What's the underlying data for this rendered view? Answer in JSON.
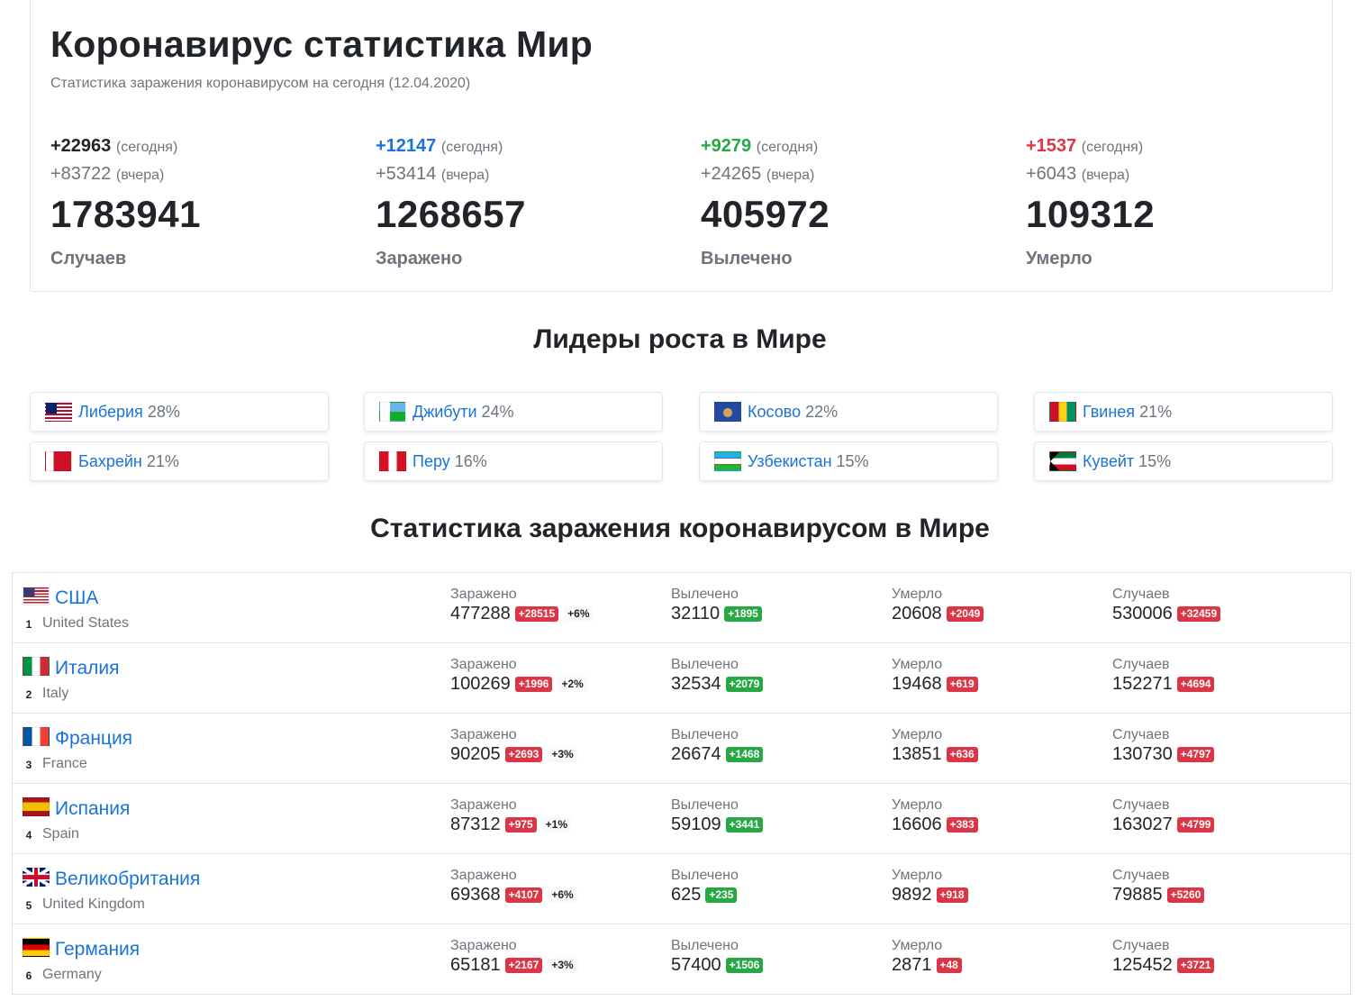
{
  "header": {
    "title": "Коронавирус статистика Мир",
    "subtitle": "Статистика заражения коронавирусом на сегодня (12.04.2020)"
  },
  "summary": [
    {
      "today": "+22963",
      "today_note": "(сегодня)",
      "yesterday": "+83722",
      "yesterday_note": "(вчера)",
      "total": "1783941",
      "label": "Случаев",
      "color": "#212529"
    },
    {
      "today": "+12147",
      "today_note": "(сегодня)",
      "yesterday": "+53414",
      "yesterday_note": "(вчера)",
      "total": "1268657",
      "label": "Заражено",
      "color": "#1a73d8"
    },
    {
      "today": "+9279",
      "today_note": "(сегодня)",
      "yesterday": "+24265",
      "yesterday_note": "(вчера)",
      "total": "405972",
      "label": "Вылечено",
      "color": "#28a745"
    },
    {
      "today": "+1537",
      "today_note": "(сегодня)",
      "yesterday": "+6043",
      "yesterday_note": "(вчера)",
      "total": "109312",
      "label": "Умерло",
      "color": "#dc3545"
    }
  ],
  "leaders": {
    "title": "Лидеры роста в Мире",
    "items": [
      {
        "name": "Либерия",
        "pct": "28%",
        "flag_icon": "liberia-flag-icon"
      },
      {
        "name": "Джибути",
        "pct": "24%",
        "flag_icon": "djibouti-flag-icon"
      },
      {
        "name": "Косово",
        "pct": "22%",
        "flag_icon": "kosovo-flag-icon"
      },
      {
        "name": "Гвинея",
        "pct": "21%",
        "flag_icon": "guinea-flag-icon"
      },
      {
        "name": "Бахрейн",
        "pct": "21%",
        "flag_icon": "bahrain-flag-icon"
      },
      {
        "name": "Перу",
        "pct": "16%",
        "flag_icon": "peru-flag-icon"
      },
      {
        "name": "Узбекистан",
        "pct": "15%",
        "flag_icon": "uzbekistan-flag-icon"
      },
      {
        "name": "Кувейт",
        "pct": "15%",
        "flag_icon": "kuwait-flag-icon"
      }
    ]
  },
  "table": {
    "title": "Статистика заражения коронавирусом в Мире",
    "labels": {
      "infected": "Заражено",
      "recovered": "Вылечено",
      "deaths": "Умерло",
      "cases": "Случаев"
    },
    "rows": [
      {
        "rank": "1",
        "name_ru": "США",
        "name_en": "United States",
        "flag_icon": "usa-flag-icon",
        "infected": "477288",
        "infected_delta": "+28515",
        "infected_pct": "+6%",
        "recovered": "32110",
        "recovered_delta": "+1895",
        "deaths": "20608",
        "deaths_delta": "+2049",
        "cases": "530006",
        "cases_delta": "+32459"
      },
      {
        "rank": "2",
        "name_ru": "Италия",
        "name_en": "Italy",
        "flag_icon": "italy-flag-icon",
        "infected": "100269",
        "infected_delta": "+1996",
        "infected_pct": "+2%",
        "recovered": "32534",
        "recovered_delta": "+2079",
        "deaths": "19468",
        "deaths_delta": "+619",
        "cases": "152271",
        "cases_delta": "+4694"
      },
      {
        "rank": "3",
        "name_ru": "Франция",
        "name_en": "France",
        "flag_icon": "france-flag-icon",
        "infected": "90205",
        "infected_delta": "+2693",
        "infected_pct": "+3%",
        "recovered": "26674",
        "recovered_delta": "+1468",
        "deaths": "13851",
        "deaths_delta": "+636",
        "cases": "130730",
        "cases_delta": "+4797"
      },
      {
        "rank": "4",
        "name_ru": "Испания",
        "name_en": "Spain",
        "flag_icon": "spain-flag-icon",
        "infected": "87312",
        "infected_delta": "+975",
        "infected_pct": "+1%",
        "recovered": "59109",
        "recovered_delta": "+3441",
        "deaths": "16606",
        "deaths_delta": "+383",
        "cases": "163027",
        "cases_delta": "+4799"
      },
      {
        "rank": "5",
        "name_ru": "Великобритания",
        "name_en": "United Kingdom",
        "flag_icon": "uk-flag-icon",
        "infected": "69368",
        "infected_delta": "+4107",
        "infected_pct": "+6%",
        "recovered": "625",
        "recovered_delta": "+235",
        "deaths": "9892",
        "deaths_delta": "+918",
        "cases": "79885",
        "cases_delta": "+5260"
      },
      {
        "rank": "6",
        "name_ru": "Германия",
        "name_en": "Germany",
        "flag_icon": "germany-flag-icon",
        "infected": "65181",
        "infected_delta": "+2167",
        "infected_pct": "+3%",
        "recovered": "57400",
        "recovered_delta": "+1506",
        "deaths": "2871",
        "deaths_delta": "+48",
        "cases": "125452",
        "cases_delta": "+3721"
      }
    ]
  }
}
